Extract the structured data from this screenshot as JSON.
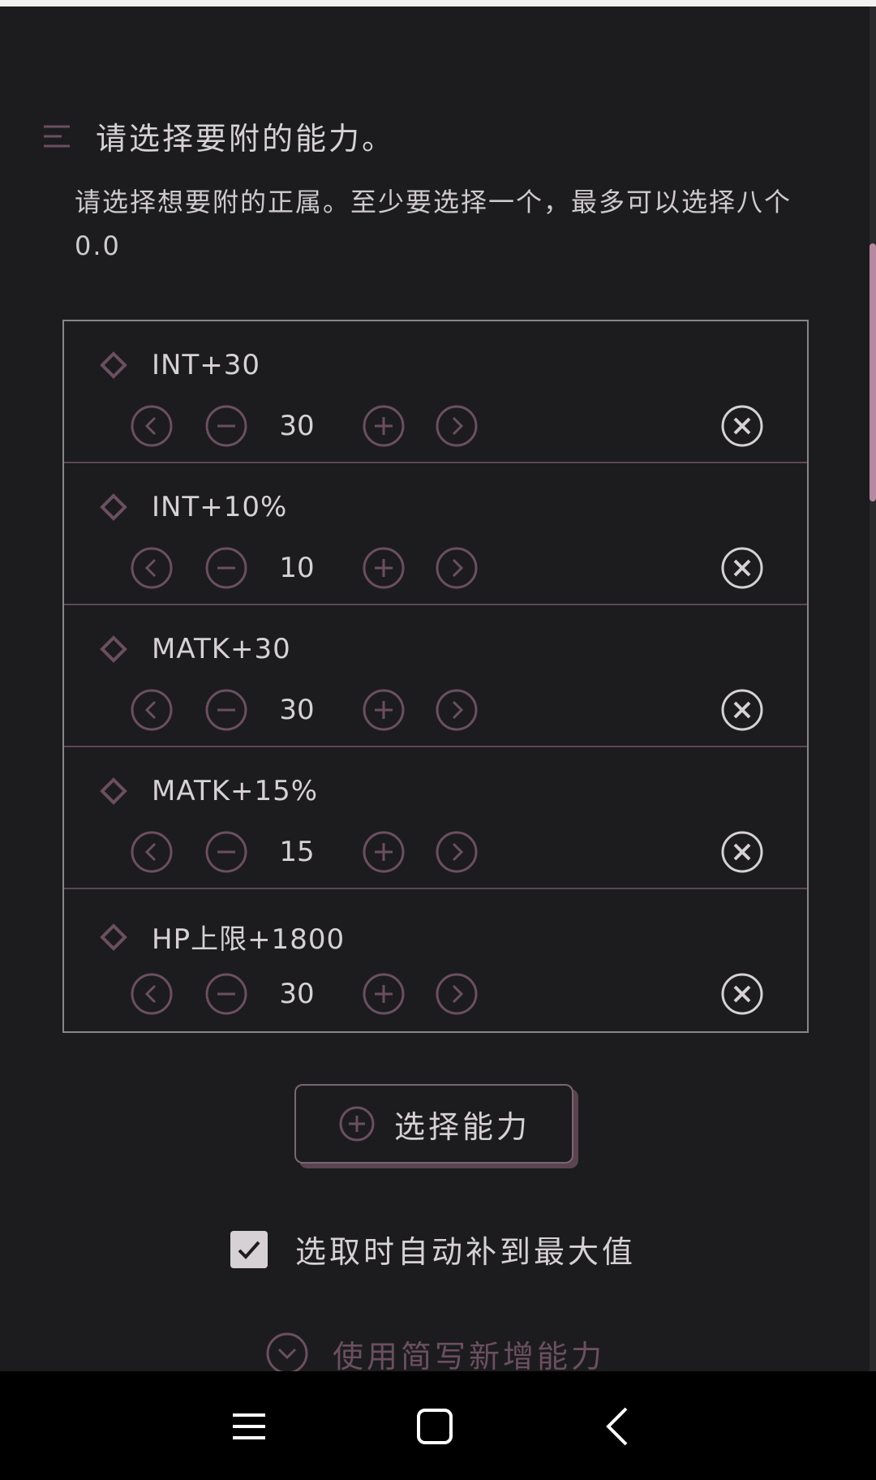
{
  "section": {
    "title": "请选择要附的能力。",
    "description": "请选择想要附的正属。至少要选择一个，最多可以选择八个0.0"
  },
  "abilities": [
    {
      "name": "INT+30",
      "value": "30"
    },
    {
      "name": "INT+10%",
      "value": "10"
    },
    {
      "name": "MATK+30",
      "value": "30"
    },
    {
      "name": "MATK+15%",
      "value": "15"
    },
    {
      "name": "HP上限+1800",
      "value": "30"
    }
  ],
  "actions": {
    "add_ability_label": "选择能力",
    "auto_fill_label": "选取时自动补到最大值",
    "auto_fill_checked": true,
    "shorthand_label": "使用简写新增能力"
  },
  "colors": {
    "background": "#1c1c1e",
    "accent": "#6b4f60",
    "text": "#d6d1d4",
    "icon": "#6b4f60"
  },
  "icons": {
    "section": "menu-lines-icon",
    "ability": "diamond-icon",
    "prev": "chevron-left-circle-icon",
    "decrement": "minus-circle-icon",
    "increment": "plus-circle-icon",
    "next": "chevron-right-circle-icon",
    "remove": "close-circle-icon",
    "add": "plus-circle-icon",
    "shorthand": "chevron-down-circle-icon"
  }
}
